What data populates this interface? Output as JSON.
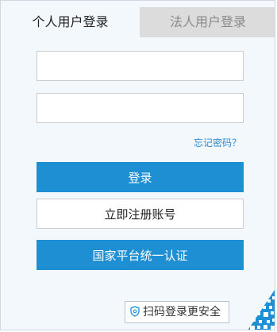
{
  "tabs": {
    "personal": "个人用户登录",
    "corporate": "法人用户登录"
  },
  "form": {
    "username_value": "",
    "password_value": "",
    "forgot_password": "忘记密码？"
  },
  "buttons": {
    "login": "登录",
    "register": "立即注册账号",
    "national_auth": "国家平台统一认证"
  },
  "scan": {
    "label": "扫码登录更安全"
  },
  "icons": {
    "scan": "shield-icon",
    "qr": "qr-code-icon"
  },
  "colors": {
    "primary": "#1e8fd2",
    "link": "#2e8bd0",
    "inactive_tab": "#dcdcdc",
    "panel_bg": "#f3f8fd"
  }
}
